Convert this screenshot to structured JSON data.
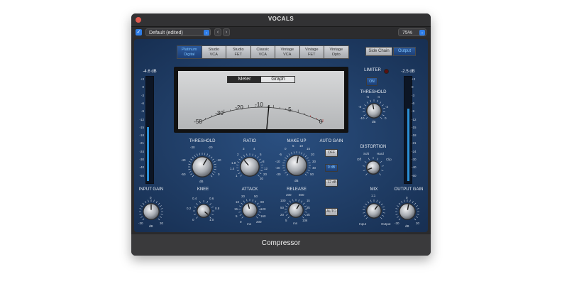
{
  "window": {
    "title": "VOCALS",
    "footer": "Compressor"
  },
  "toolbar": {
    "preset": "Default (edited)",
    "zoom": "75%",
    "back": "‹",
    "forward": "›",
    "check": "✓",
    "arrow": "⌄"
  },
  "modes": [
    {
      "l1": "Platinum",
      "l2": "Digital",
      "active": true
    },
    {
      "l1": "Studio",
      "l2": "VCA",
      "active": false
    },
    {
      "l1": "Studio",
      "l2": "FET",
      "active": false
    },
    {
      "l1": "Classic",
      "l2": "VCA",
      "active": false
    },
    {
      "l1": "Vintage",
      "l2": "VCA",
      "active": false
    },
    {
      "l1": "Vintage",
      "l2": "FET",
      "active": false
    },
    {
      "l1": "Vintage",
      "l2": "Opto",
      "active": false
    }
  ],
  "sidechain": {
    "side": "Side Chain",
    "output": "Output"
  },
  "meter": {
    "tab_meter": "Meter",
    "tab_graph": "Graph",
    "scale": [
      "-50",
      "-30",
      "-20",
      "-10",
      "-5",
      "0"
    ]
  },
  "input": {
    "value": "-4.6 dB",
    "label": "INPUT GAIN",
    "level": 0.52,
    "scale": [
      "+3",
      "0",
      "-3",
      "-6",
      "-9",
      "-12",
      "-15",
      "-18",
      "-21",
      "-24",
      "-30",
      "-40",
      "-60"
    ],
    "knob_ticks": [
      "0",
      "-30",
      "30",
      "dB"
    ]
  },
  "output": {
    "value": "-2.5 dB",
    "label": "OUTPUT GAIN",
    "level": 0.7,
    "scale": [
      "+3",
      "0",
      "-3",
      "-6",
      "-9",
      "-12",
      "-15",
      "-18",
      "-21",
      "-24",
      "-30",
      "-40",
      "-60"
    ],
    "knob_ticks": [
      "0",
      "-30",
      "30",
      "dB"
    ]
  },
  "threshold": {
    "label": "THRESHOLD",
    "ticks": [
      "-30",
      "-20",
      "-40",
      "-10",
      "-50",
      "0",
      "dB"
    ]
  },
  "ratio": {
    "label": "RATIO",
    "ticks": [
      "3",
      "4",
      "2",
      "5",
      "8",
      "1.4",
      "1.8",
      "12",
      "20",
      "30",
      "1"
    ]
  },
  "makeup": {
    "label": "MAKE UP",
    "ticks": [
      "5",
      "10",
      "0",
      "15",
      "-5",
      "20",
      "-10",
      "30",
      "-20",
      "40",
      "-30",
      "50",
      "dB"
    ]
  },
  "autogain": {
    "label": "AUTO GAIN",
    "off": "OFF",
    "zero": "0 dB",
    "minus12": "-12 dB"
  },
  "knee": {
    "label": "KNEE",
    "ticks": [
      "0.4",
      "0.6",
      "0.2",
      "0.8",
      "0",
      "1.0"
    ]
  },
  "attack": {
    "label": "ATTACK",
    "ticks": [
      "20",
      "50",
      "10",
      "80",
      "15",
      "120",
      "5",
      "160",
      "0",
      "200",
      "ms"
    ]
  },
  "release": {
    "label": "RELEASE",
    "ticks": [
      "200",
      "500",
      "100",
      "1k",
      "50",
      "2k",
      "20",
      "5k",
      "5",
      "10k",
      "ms"
    ],
    "auto": "AUTO"
  },
  "limiter": {
    "label": "LIMITER",
    "on": "ON"
  },
  "rthreshold": {
    "label": "THRESHOLD",
    "ticks": [
      "-6",
      "-4",
      "-8",
      "-2",
      "-10",
      "0",
      "dB"
    ]
  },
  "distortion": {
    "label": "DISTORTION",
    "soft": "Soft",
    "hard": "Hard",
    "off": "Off",
    "clip": "Clip"
  },
  "mix": {
    "label": "MIX",
    "ratio": "1:1",
    "input": "Input",
    "output": "Output"
  },
  "colors": {
    "panel": "#1f3c64",
    "accent": "#2f7de6",
    "led": "#7ec4ff",
    "close": "#e25a4f"
  }
}
